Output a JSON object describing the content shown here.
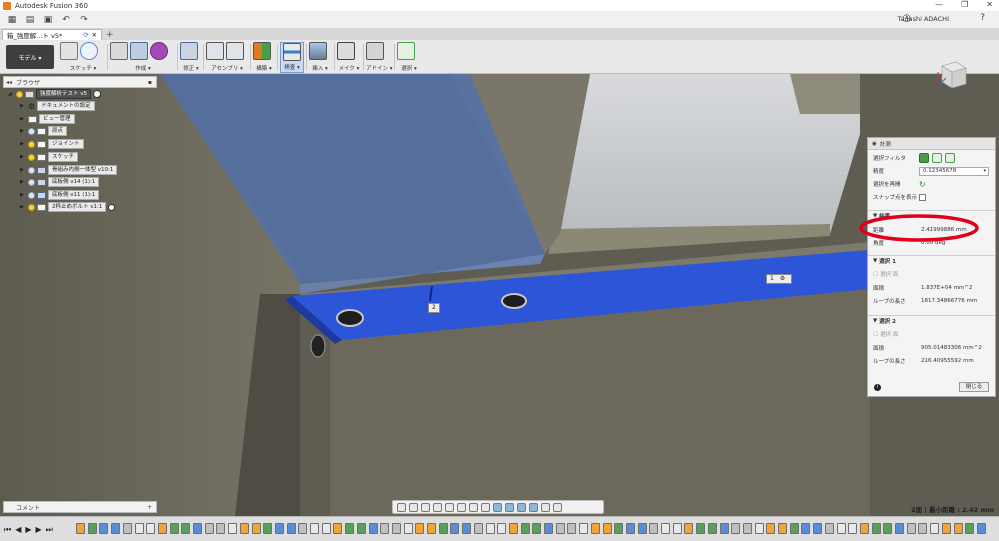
{
  "window": {
    "title": "Autodesk Fusion 360",
    "controls": [
      "—",
      "❐",
      "✕"
    ]
  },
  "quickbar": {
    "user": "Tadashi ADACHI",
    "help": "?"
  },
  "tab": {
    "label": "箱_強度解...ト v5*",
    "close": "✕",
    "new": "+"
  },
  "ribbon": {
    "workspace": "モデル ▾",
    "groups": [
      "スケッチ ▾",
      "作成 ▾",
      "修正 ▾",
      "アセンブリ ▾",
      "構築 ▾",
      "検査 ▾",
      "挿入 ▾",
      "メイク ▾",
      "アドイン ▾",
      "選択 ▾"
    ]
  },
  "browser": {
    "title": "ブラウザ",
    "items": [
      {
        "label": "強度解析テスト v5",
        "indent": 0,
        "dark": true,
        "bulb": true
      },
      {
        "label": "ドキュメントの設定",
        "indent": 1
      },
      {
        "label": "ビュー管理",
        "indent": 1
      },
      {
        "label": "原点",
        "indent": 1,
        "bulb": true,
        "off": true
      },
      {
        "label": "ジョイント",
        "indent": 1,
        "bulb": true
      },
      {
        "label": "スケッチ",
        "indent": 1,
        "bulb": true
      },
      {
        "label": "骨組み内側一体型 v10:1",
        "indent": 1,
        "bulb": true,
        "off": true
      },
      {
        "label": "底板側 v14 (1):1",
        "indent": 1,
        "bulb": true,
        "off": true
      },
      {
        "label": "底板側 v11 (1):1",
        "indent": 1,
        "bulb": true,
        "off": true
      },
      {
        "label": "2枠止めボルト v1:1",
        "indent": 1,
        "bulb": true
      }
    ]
  },
  "comments": {
    "title": "コメント",
    "add": "+"
  },
  "measure": {
    "title": "計測",
    "filter_label": "選択フィルタ",
    "precision_label": "精度",
    "precision_value": "0.12345678",
    "toggle_label": "選択を再開",
    "snap_label": "スナップ点を表示",
    "result_title": "結果",
    "distance_label": "距離",
    "distance_value": "2.41999886 mm",
    "angle_label": "角度",
    "angle_value": "0.00 deg",
    "sel1_title": "選択 1",
    "sel1_kind": "選択 面",
    "sel1_area_label": "面積",
    "sel1_area_value": "1.837E+04 mm^2",
    "sel1_loop_label": "ループの長さ",
    "sel1_loop_value": "1817.34866776 mm",
    "sel2_title": "選択 2",
    "sel2_kind": "選択 面",
    "sel2_area_label": "面積",
    "sel2_area_value": "905.01483306 mm^2",
    "sel2_loop_label": "ループの長さ",
    "sel2_loop_value": "216.40955592 mm",
    "close": "閉じる"
  },
  "viewport": {
    "label_1": "1",
    "label_2": "2",
    "status": "2面 | 最小距離 : 2.42 mm"
  },
  "colors": {
    "accent_blue": "#2d55d8",
    "selection_highlight": "#3b5fae",
    "annotation_red": "#e1001b"
  }
}
